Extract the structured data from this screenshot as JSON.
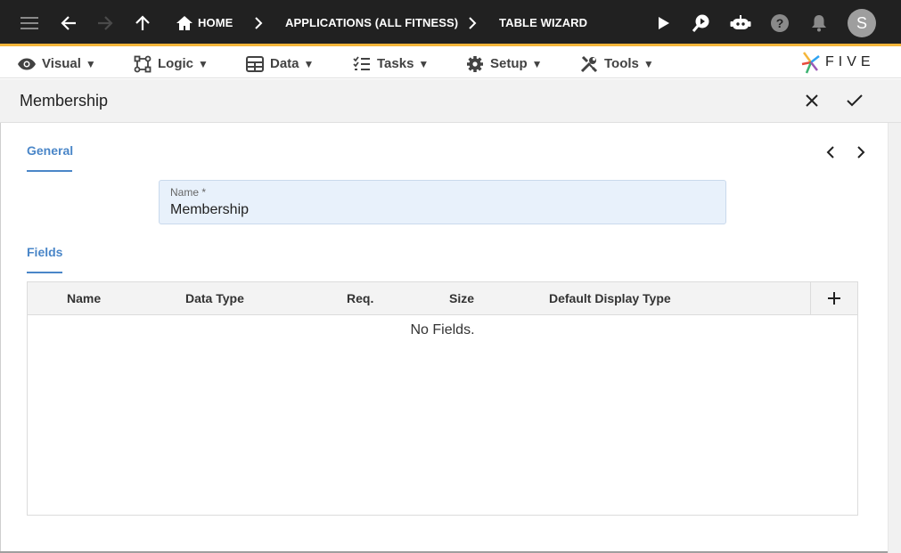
{
  "topbar": {
    "breadcrumbs": [
      "HOME",
      "APPLICATIONS (ALL FITNESS)",
      "TABLE WIZARD"
    ],
    "avatar_initial": "S",
    "accent_color": "#f5b63a"
  },
  "menu": {
    "items": [
      {
        "label": "Visual",
        "icon": "eye-icon"
      },
      {
        "label": "Logic",
        "icon": "logic-flow-icon"
      },
      {
        "label": "Data",
        "icon": "table-icon"
      },
      {
        "label": "Tasks",
        "icon": "checklist-icon"
      },
      {
        "label": "Setup",
        "icon": "gear-icon"
      },
      {
        "label": "Tools",
        "icon": "tools-icon"
      }
    ],
    "caret": "▼",
    "logo_text": "FIVE"
  },
  "form": {
    "title": "Membership",
    "general_tab": "General",
    "name_label": "Name *",
    "name_value": "Membership",
    "fields_tab": "Fields",
    "columns": [
      "Name",
      "Data Type",
      "Req.",
      "Size",
      "Default Display Type"
    ],
    "empty_message": "No Fields.",
    "accent_color": "#4a86c8"
  }
}
